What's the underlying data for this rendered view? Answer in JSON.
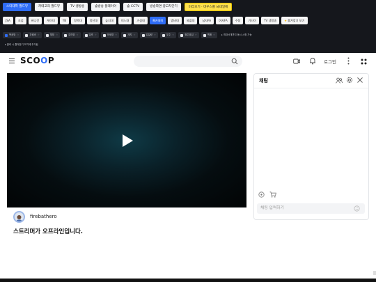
{
  "top_bar": {
    "row1": [
      {
        "label": "스타대학 월드뷰",
        "style": "blue"
      },
      {
        "label": "카테고리 월드뷰",
        "style": "plain"
      },
      {
        "label": "TV 생방송",
        "style": "plain"
      },
      {
        "label": "숲방송 플레이어",
        "style": "plain"
      },
      {
        "label": "숲 CCTV",
        "style": "plain"
      },
      {
        "label": "방송화면 광고차단기",
        "style": "plain"
      },
      {
        "label": "미리보기 · 마우스를 놔네일에",
        "style": "yellow"
      }
    ],
    "row2": [
      {
        "label": "JSA",
        "style": "plain"
      },
      {
        "label": "조검",
        "style": "plain"
      },
      {
        "label": "버니건",
        "style": "plain"
      },
      {
        "label": "케이대",
        "style": "plain"
      },
      {
        "label": "YB",
        "style": "plain"
      },
      {
        "label": "정목대",
        "style": "plain"
      },
      {
        "label": "정선대",
        "style": "plain"
      },
      {
        "label": "늪지대",
        "style": "plain"
      },
      {
        "label": "미느대",
        "style": "plain"
      },
      {
        "label": "거성대",
        "style": "plain"
      },
      {
        "label": "흑카데미",
        "style": "blue"
      },
      {
        "label": "엠비대",
        "style": "plain"
      },
      {
        "label": "와플대",
        "style": "plain"
      },
      {
        "label": "남자FA",
        "style": "plain"
      },
      {
        "label": "여자FA",
        "style": "plain"
      },
      {
        "label": "수장",
        "style": "plain"
      },
      {
        "label": "기타이",
        "style": "plain"
      },
      {
        "label": "TV 생방송",
        "style": "plain"
      },
      {
        "label": "즐겨찾기 보기",
        "style": "fav"
      }
    ],
    "row3": [
      {
        "label": "목공방",
        "checked": true
      },
      {
        "label": "우림바",
        "checked": false
      },
      {
        "label": "체방",
        "checked": false
      },
      {
        "label": "김의양",
        "checked": false
      },
      {
        "label": "임조",
        "checked": false
      },
      {
        "label": "와세영",
        "checked": false
      },
      {
        "label": "재지",
        "checked": false
      },
      {
        "label": "김일량",
        "checked": false
      },
      {
        "label": "우주",
        "checked": false
      },
      {
        "label": "정주호섬",
        "checked": false
      },
      {
        "label": "맥애",
        "checked": false
      }
    ],
    "row3_note": "▸ 최대 6개까지 동시 시청 가능",
    "row4_note": "▸ 클릭 시 즐겨찾기 보기에 추가됨"
  },
  "header": {
    "logo_left": "SC",
    "logo_o1": "O",
    "logo_o2": "O",
    "logo_right": "P",
    "login": "로그인"
  },
  "video": {
    "state": "paused"
  },
  "streamer": {
    "name": "firebathero",
    "offline_message": "스트리머가 오프라인입니다."
  },
  "chat": {
    "title": "채팅",
    "input_placeholder": "채팅 입력하기"
  },
  "colors": {
    "accent": "#2f6df6",
    "topbar_bg": "#15171c",
    "highlight_yellow": "#ffe14d"
  }
}
